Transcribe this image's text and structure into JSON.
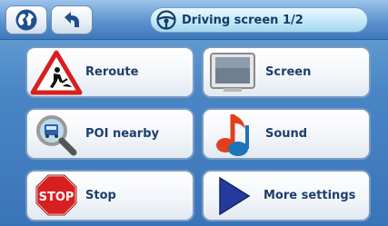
{
  "header": {
    "title": "Driving screen 1/2",
    "globe_icon": "globe-icon",
    "back_icon": "back-arrow-icon",
    "title_icon": "steering-wheel-icon"
  },
  "menu": {
    "items": [
      {
        "label": "Reroute",
        "icon": "road-works-icon"
      },
      {
        "label": "Screen",
        "icon": "monitor-icon"
      },
      {
        "label": "POI nearby",
        "icon": "magnifier-icon"
      },
      {
        "label": "Sound",
        "icon": "music-note-icon"
      },
      {
        "label": "Stop",
        "icon": "stop-sign-icon"
      },
      {
        "label": "More settings",
        "icon": "play-arrow-icon"
      }
    ]
  },
  "icons": {
    "stop_sign_text": "STOP"
  },
  "colors": {
    "background": "#4a86c6",
    "tile_border": "#7a9cc2",
    "label": "#1d3f6b",
    "title": "#163a66"
  }
}
